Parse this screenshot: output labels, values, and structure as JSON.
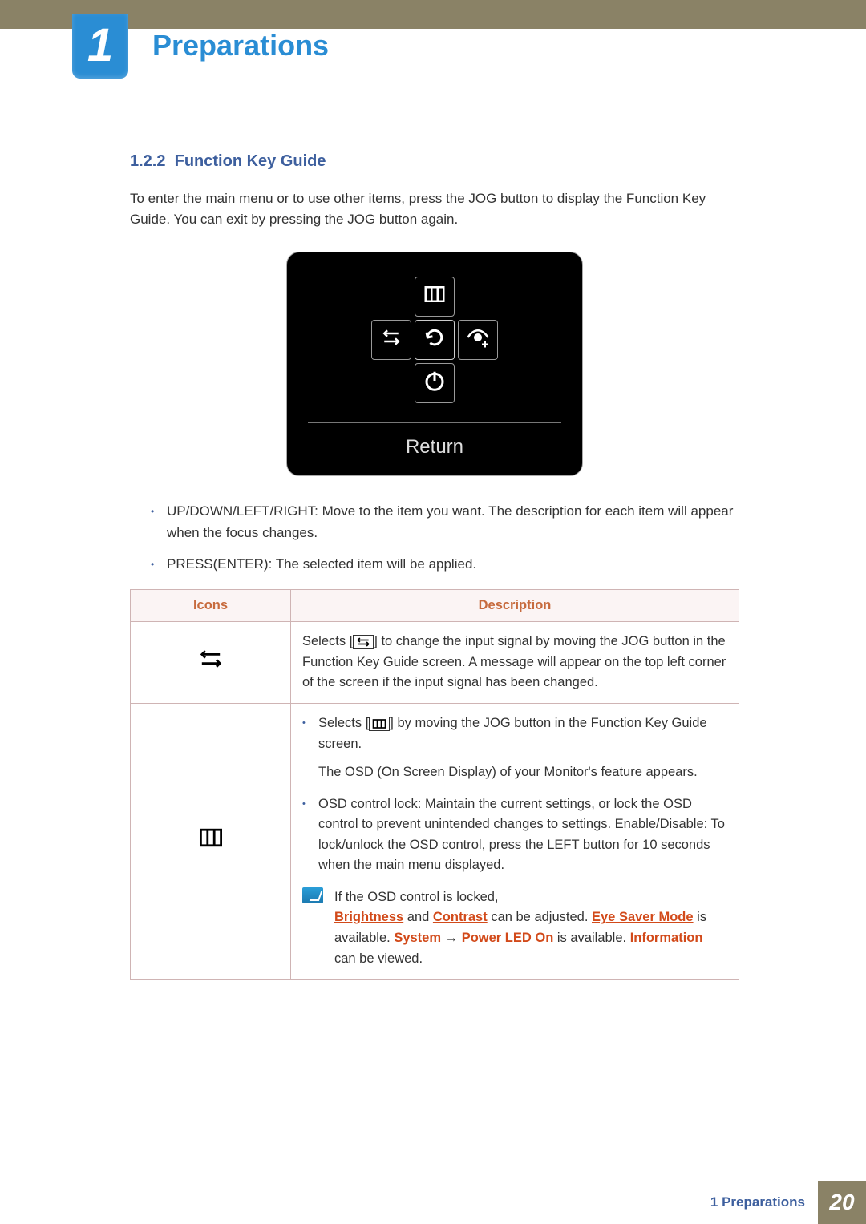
{
  "chapter": {
    "number": "1",
    "title": "Preparations"
  },
  "section": {
    "number": "1.2.2",
    "heading": "Function Key Guide"
  },
  "intro": "To enter the main menu or to use other items, press the JOG button to display the Function Key Guide. You can exit by pressing the JOG button again.",
  "osd": {
    "return_label": "Return"
  },
  "bullets": {
    "b0": "UP/DOWN/LEFT/RIGHT: Move to the item you want. The description for each item will appear when the focus changes.",
    "b1": "PRESS(ENTER): The selected item will be applied."
  },
  "table": {
    "header_icons": "Icons",
    "header_desc": "Description",
    "row0_desc_pre": "Selects [",
    "row0_desc_post": "] to change the input signal by moving the JOG button in the Function Key Guide screen. A message will appear on the top left corner of the screen if the input signal has been changed.",
    "row1_b1_pre": "Selects [",
    "row1_b1_post": "] by moving the JOG button in the Function Key Guide screen.",
    "row1_b1_p2": "The OSD (On Screen Display) of your Monitor's feature appears.",
    "row1_b2": "OSD control lock: Maintain the current settings, or lock the OSD control to prevent unintended changes to settings. Enable/Disable: To lock/unlock the OSD control, press the LEFT button for 10 seconds when the main menu displayed.",
    "row1_note_intro": "If the OSD control is locked,",
    "row1_note_brightness": "Brightness",
    "row1_note_and": " and ",
    "row1_note_contrast": "Contrast",
    "row1_note_t1": " can be adjusted. ",
    "row1_note_eye": "Eye Saver Mode",
    "row1_note_t2": " is available. ",
    "row1_note_system": "System",
    "row1_note_arrow": " → ",
    "row1_note_pled": "Power LED On",
    "row1_note_t3": " is available. ",
    "row1_note_info": "Information",
    "row1_note_t4": " can be viewed."
  },
  "footer": {
    "text": "1 Preparations",
    "page": "20"
  }
}
